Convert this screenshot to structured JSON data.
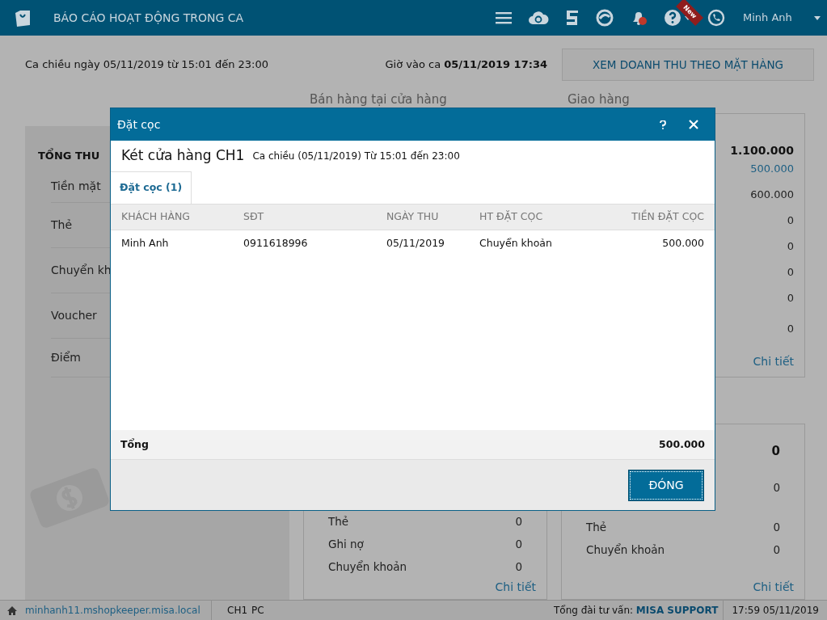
{
  "header": {
    "title": "BÁO CÁO HOẠT ĐỘNG TRONG CA",
    "new_badge": "New",
    "user": "Minh Anh"
  },
  "shift": {
    "label": "Ca chiều ngày 05/11/2019 từ 15:01 đến 23:00",
    "checkin": "Giờ vào ca **05/11/2019 17:34**",
    "button": "XEM DOANH THU THEO MẶT HÀNG"
  },
  "section_headings": [
    "Bán hàng tại cửa hàng",
    "Giao hàng"
  ],
  "total_panel": {
    "title": "TỔNG THU",
    "items": [
      "Tiền mặt",
      "Thẻ",
      "Chuyển kh",
      "Voucher",
      "Điểm"
    ]
  },
  "delivery_panel": {
    "values": [
      {
        "text": "1.100.000",
        "kind": "total"
      },
      {
        "text": "500.000",
        "kind": "link"
      },
      {
        "text": "600.000",
        "kind": "plain"
      },
      {
        "text": "0",
        "kind": "plain"
      },
      {
        "text": "0",
        "kind": "plain"
      },
      {
        "text": "0",
        "kind": "plain"
      },
      {
        "text": "0",
        "kind": "plain"
      },
      {
        "text": "0",
        "kind": "plain"
      }
    ],
    "link": "Chi tiết"
  },
  "lower_store_panel": {
    "rows": [
      {
        "label": "Thẻ",
        "value": "0"
      },
      {
        "label": "Ghi nợ",
        "value": "0"
      },
      {
        "label": "Chuyển khoản",
        "value": "0"
      }
    ],
    "link": "Chi tiết"
  },
  "lower_delivery_panel": {
    "total": "0",
    "rows": [
      {
        "label": "",
        "value": "0"
      },
      {
        "label": "Thẻ",
        "value": "0"
      },
      {
        "label": "Chuyển khoản",
        "value": "0"
      }
    ],
    "link": "Chi tiết"
  },
  "dialog": {
    "title": "Đặt cọc",
    "heading": "Két cửa hàng CH1",
    "subheading": "Ca chiều (05/11/2019) Từ 15:01 đến 23:00",
    "tabs": [
      {
        "label": "Đặt cọc (1)",
        "selected": true
      }
    ],
    "table": {
      "columns": [
        "KHÁCH HÀNG",
        "SĐT",
        "NGÀY THU",
        "HT ĐẶT CỌC",
        "TIỀN ĐẶT CỌC"
      ],
      "rows": [
        [
          "Minh Anh",
          "0911618996",
          "05/11/2019",
          "Chuyển khoản",
          "500.000"
        ]
      ],
      "total_label": "Tổng",
      "total_value": "500.000"
    },
    "button": "ĐÓNG"
  },
  "status_bar": {
    "host": "minhanh11.mshopkeeper.misa.local",
    "store": "CH1",
    "device": "PC",
    "support": "Tổng đài tư vấn: **MISA SUPPORT**",
    "time": "17:59 05/11/2019"
  }
}
